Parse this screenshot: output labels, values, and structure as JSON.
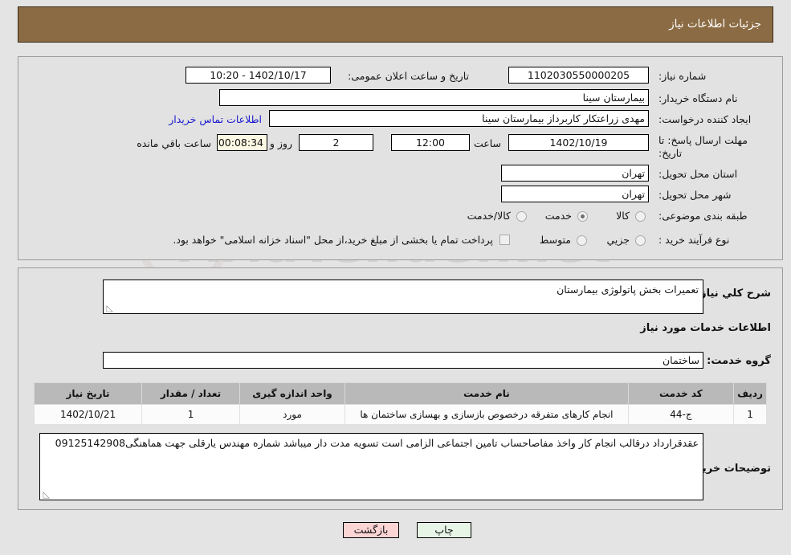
{
  "header": {
    "title": "جزئیات اطلاعات نیاز",
    "bar_color": "#8b6b43"
  },
  "watermark": {
    "text": "AriaTender.net",
    "shield_icon": "shield-icon"
  },
  "top_panel": {
    "need_number": {
      "label": "شماره نیاز:",
      "value": "1102030550000205"
    },
    "announce_datetime": {
      "label": "تاریخ و ساعت اعلان عمومی:",
      "value": "1402/10/17 - 10:20"
    },
    "buyer_org": {
      "label": "نام دستگاه خریدار:",
      "value": "بیمارستان سینا"
    },
    "request_creator": {
      "label": "ایجاد کننده درخواست:",
      "value": "مهدی  زراعتکار  کاربرداز بیمارستان سینا"
    },
    "buyer_contact_link": "اطلاعات تماس خریدار",
    "deadline": {
      "label": "مهلت ارسال پاسخ: تا تاریخ:",
      "date": "1402/10/19",
      "time_label": "ساعت",
      "time": "12:00",
      "days": "2",
      "days_suffix": "روز و",
      "countdown": "00:08:34",
      "countdown_suffix": "ساعت باقي مانده"
    },
    "delivery_province": {
      "label": "استان محل تحویل:",
      "value": "تهران"
    },
    "delivery_city": {
      "label": "شهر محل تحویل:",
      "value": "تهران"
    },
    "category": {
      "label": "طبقه بندی موضوعی:",
      "options": [
        {
          "label": "کالا",
          "selected": false
        },
        {
          "label": "خدمت",
          "selected": true
        },
        {
          "label": "کالا/خدمت",
          "selected": false
        }
      ]
    },
    "purchase_process": {
      "label": "نوع فرآیند خرید :",
      "options": [
        {
          "label": "جزیي",
          "selected": false
        },
        {
          "label": "متوسط",
          "selected": false
        }
      ],
      "checkbox_label": "پرداخت تمام یا بخشی از مبلغ خرید،از محل \"اسناد خزانه اسلامی\" خواهد بود.",
      "checkbox_checked": false
    }
  },
  "bottom_panel": {
    "general_description": {
      "label": "شرح کلي نیاز:",
      "value": "تعمیرات بخش پاتولوژی بیمارستان"
    },
    "services_heading": "اطلاعات خدمات مورد نیاز",
    "service_group": {
      "label": "گروه خدمت:",
      "value": "ساختمان"
    },
    "table": {
      "columns": [
        "ردیف",
        "کد خدمت",
        "نام خدمت",
        "واحد اندازه گیری",
        "تعداد / مقدار",
        "تاریخ نیاز"
      ],
      "rows": [
        [
          "1",
          "ج-44",
          "انجام کارهای متفرقه درخصوص بازسازی و بهسازی ساختمان ها",
          "مورد",
          "1",
          "1402/10/21"
        ]
      ]
    },
    "buyer_notes": {
      "label": "توضیحات خریدار:",
      "value": "عقدقرارداد درقالب انجام کار واخذ مفاصاحساب تامین اجتماعی الزامی است تسویه مدت دار میباشد شماره مهندس یارقلی جهت هماهنگی09125142908"
    }
  },
  "footer": {
    "print_label": "چاپ",
    "back_label": "بازگشت",
    "print_color": "#e6f5e6",
    "back_color": "#fbd4d4"
  }
}
